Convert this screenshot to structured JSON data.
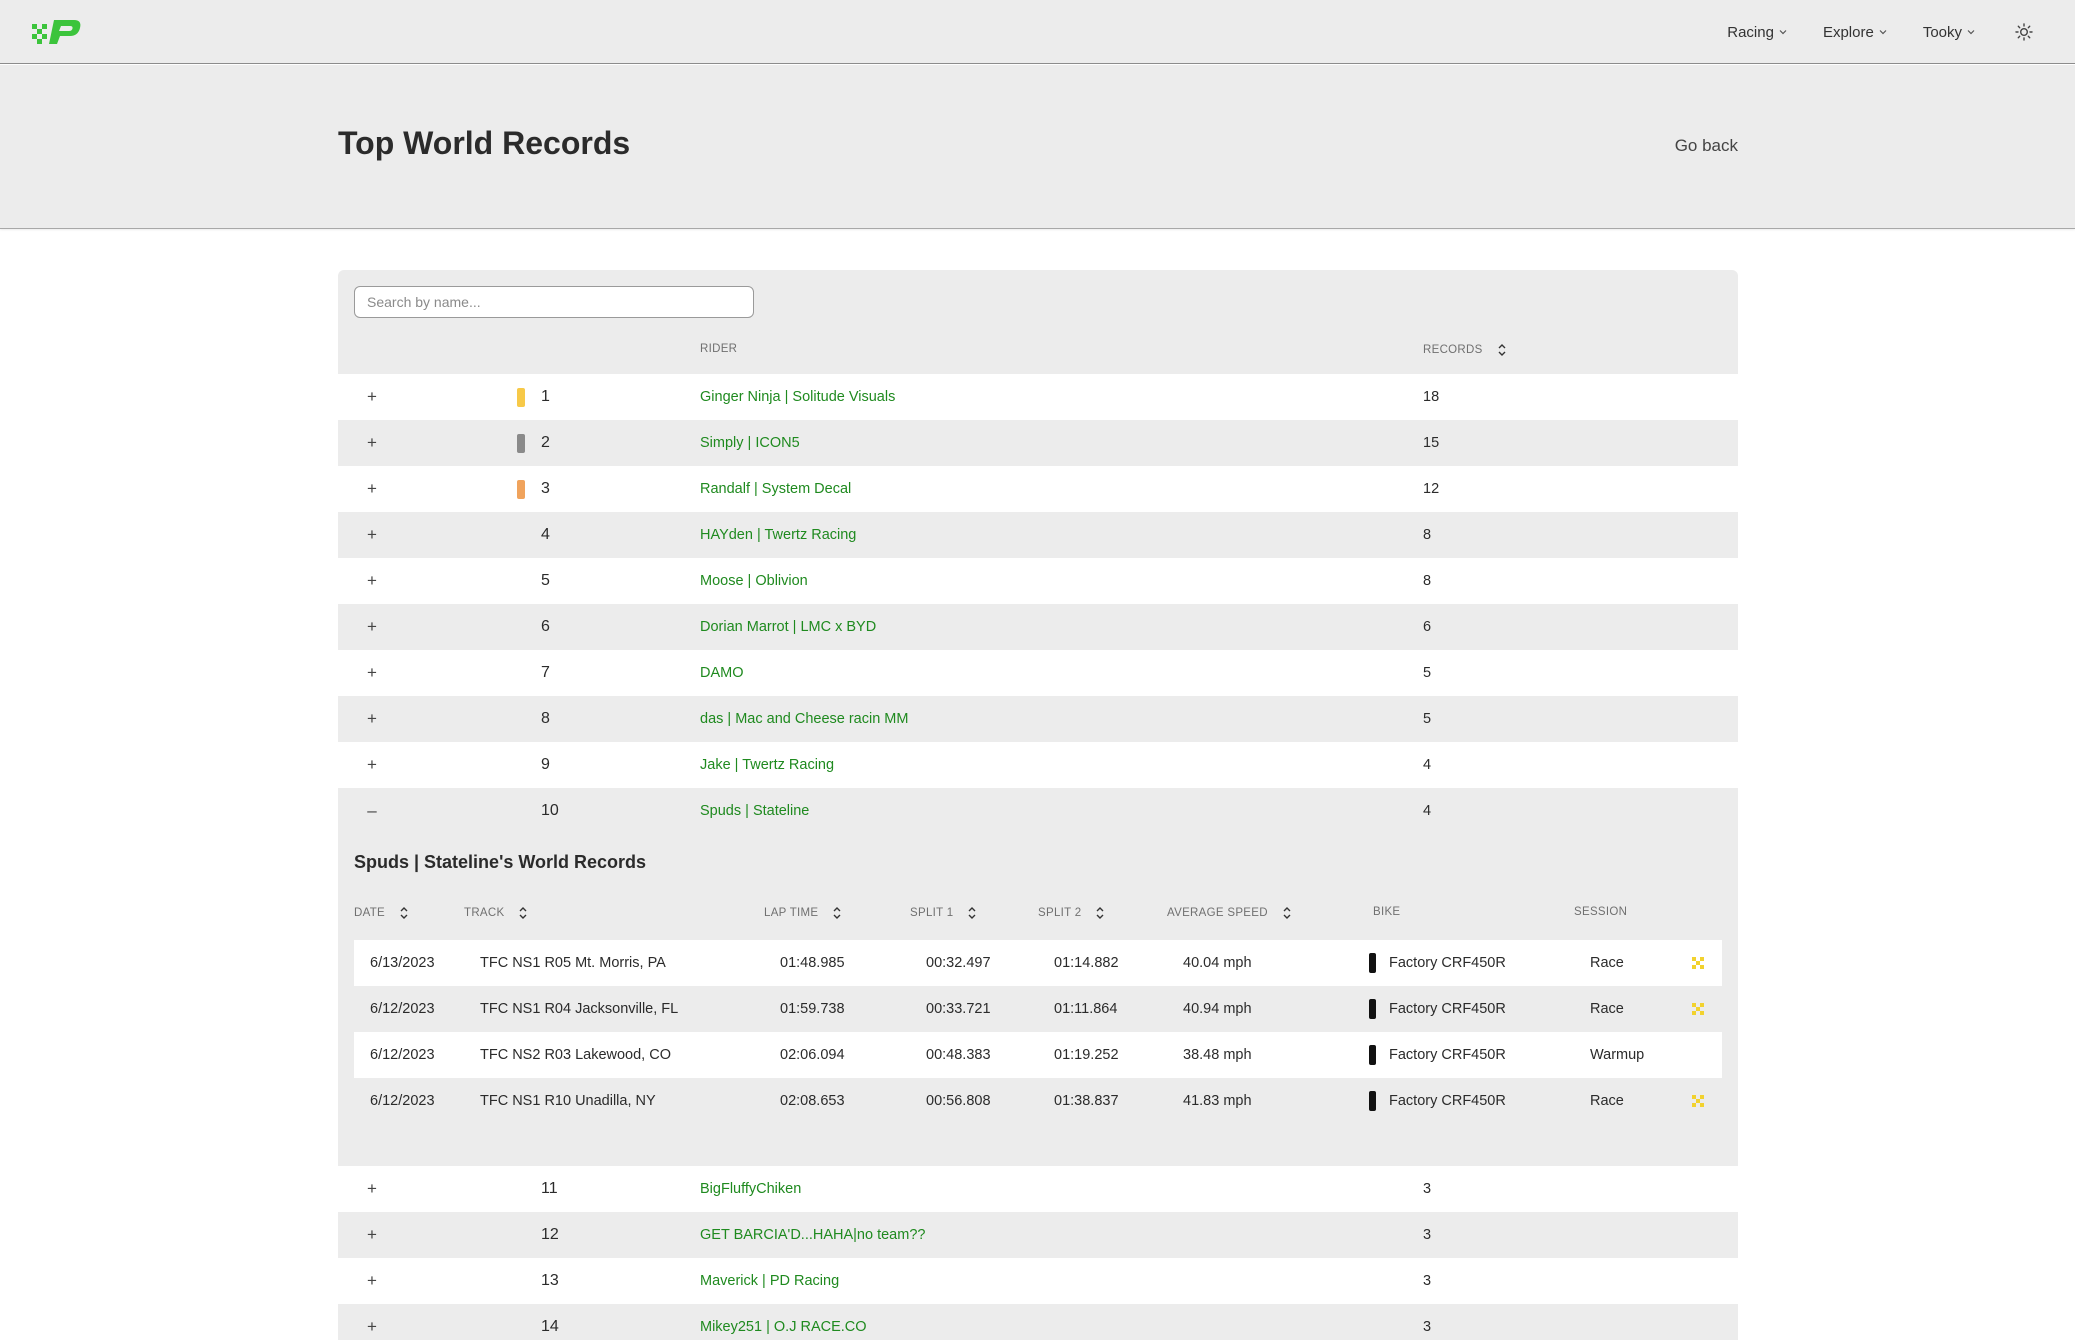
{
  "nav": {
    "items": [
      {
        "label": "Racing"
      },
      {
        "label": "Explore"
      },
      {
        "label": "Tooky"
      }
    ],
    "theme_icon": "sun-icon"
  },
  "header": {
    "title": "Top World Records",
    "back_label": "Go back"
  },
  "search": {
    "placeholder": "Search by name..."
  },
  "table": {
    "headers": {
      "rider": "RIDER",
      "records": "RECORDS"
    },
    "rows": [
      {
        "expander": "+",
        "rank": "1",
        "rider": "Ginger Ninja | Solitude Visuals",
        "records": "18",
        "medal": "#f7c948"
      },
      {
        "expander": "+",
        "rank": "2",
        "rider": "Simply | ICON5",
        "records": "15",
        "medal": "#8a8a8a"
      },
      {
        "expander": "+",
        "rank": "3",
        "rider": "Randalf | System Decal",
        "records": "12",
        "medal": "#f0a35c"
      },
      {
        "expander": "+",
        "rank": "4",
        "rider": "HAYden | Twertz Racing",
        "records": "8",
        "medal": ""
      },
      {
        "expander": "+",
        "rank": "5",
        "rider": "Moose | Oblivion",
        "records": "8",
        "medal": ""
      },
      {
        "expander": "+",
        "rank": "6",
        "rider": "Dorian Marrot | LMC x BYD",
        "records": "6",
        "medal": ""
      },
      {
        "expander": "+",
        "rank": "7",
        "rider": "DAMO",
        "records": "5",
        "medal": ""
      },
      {
        "expander": "+",
        "rank": "8",
        "rider": "das | Mac and Cheese racin MM",
        "records": "5",
        "medal": ""
      },
      {
        "expander": "+",
        "rank": "9",
        "rider": "Jake | Twertz Racing",
        "records": "4",
        "medal": ""
      },
      {
        "expander": "–",
        "rank": "10",
        "rider": "Spuds | Stateline",
        "records": "4",
        "medal": ""
      }
    ],
    "rows_after": [
      {
        "expander": "+",
        "rank": "11",
        "rider": "BigFluffyChiken",
        "records": "3",
        "medal": ""
      },
      {
        "expander": "+",
        "rank": "12",
        "rider": "GET BARCIA'D...HAHA|no team??",
        "records": "3",
        "medal": ""
      },
      {
        "expander": "+",
        "rank": "13",
        "rider": "Maverick | PD Racing",
        "records": "3",
        "medal": ""
      },
      {
        "expander": "+",
        "rank": "14",
        "rider": "Mikey251 | O.J RACE.CO",
        "records": "3",
        "medal": ""
      }
    ]
  },
  "detail": {
    "title": "Spuds | Stateline's World Records",
    "headers": {
      "date": "DATE",
      "track": "TRACK",
      "lap_time": "LAP TIME",
      "split1": "SPLIT 1",
      "split2": "SPLIT 2",
      "avg_speed": "AVERAGE SPEED",
      "bike": "BIKE",
      "session": "SESSION"
    },
    "rows": [
      {
        "date": "6/13/2023",
        "track": "TFC NS1 R05 Mt. Morris, PA",
        "lap_time": "01:48.985",
        "split1": "00:32.497",
        "split2": "01:14.882",
        "avg_speed": "40.04 mph",
        "bike": "Factory CRF450R",
        "session": "Race",
        "flag": true
      },
      {
        "date": "6/12/2023",
        "track": "TFC NS1 R04 Jacksonville, FL",
        "lap_time": "01:59.738",
        "split1": "00:33.721",
        "split2": "01:11.864",
        "avg_speed": "40.94 mph",
        "bike": "Factory CRF450R",
        "session": "Race",
        "flag": true
      },
      {
        "date": "6/12/2023",
        "track": "TFC NS2 R03 Lakewood, CO",
        "lap_time": "02:06.094",
        "split1": "00:48.383",
        "split2": "01:19.252",
        "avg_speed": "38.48 mph",
        "bike": "Factory CRF450R",
        "session": "Warmup",
        "flag": false
      },
      {
        "date": "6/12/2023",
        "track": "TFC NS1 R10 Unadilla, NY",
        "lap_time": "02:08.653",
        "split1": "00:56.808",
        "split2": "01:38.837",
        "avg_speed": "41.83 mph",
        "bike": "Factory CRF450R",
        "session": "Race",
        "flag": true
      }
    ]
  },
  "colors": {
    "accent_green": "#1f8a1f",
    "logo_green": "#3cc43c",
    "flag_yellow": "#f2d22e"
  }
}
